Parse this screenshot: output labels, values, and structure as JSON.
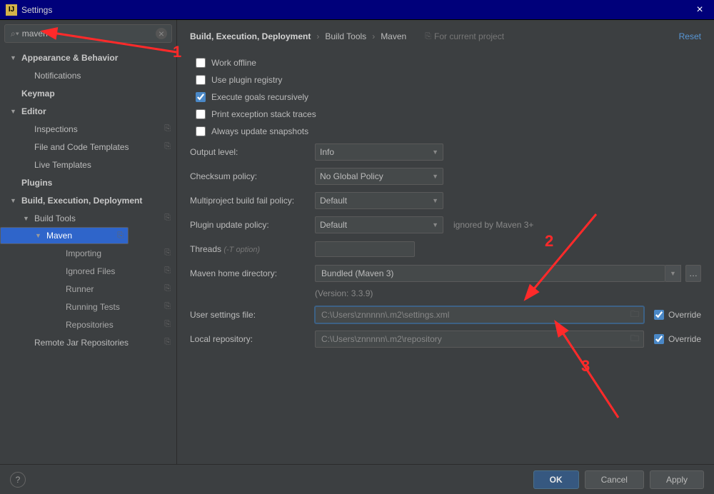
{
  "title": "Settings",
  "search": {
    "value": "maven"
  },
  "sidebar": [
    {
      "label": "Appearance & Behavior",
      "level": 0,
      "expandable": true,
      "expanded": true
    },
    {
      "label": "Notifications",
      "level": 1
    },
    {
      "label": "Keymap",
      "level": 0,
      "bold": true
    },
    {
      "label": "Editor",
      "level": 0,
      "expandable": true,
      "expanded": true
    },
    {
      "label": "Inspections",
      "level": 1,
      "copy": true
    },
    {
      "label": "File and Code Templates",
      "level": 1,
      "copy": true
    },
    {
      "label": "Live Templates",
      "level": 1
    },
    {
      "label": "Plugins",
      "level": 0,
      "bold": true
    },
    {
      "label": "Build, Execution, Deployment",
      "level": 0,
      "expandable": true,
      "expanded": true
    },
    {
      "label": "Build Tools",
      "level": 1,
      "expandable": true,
      "expanded": true,
      "copy": true
    },
    {
      "label": "Maven",
      "level": 2,
      "selected": true,
      "expandable": true,
      "expanded": true,
      "copy": true
    },
    {
      "label": "Importing",
      "level": 3,
      "copy": true
    },
    {
      "label": "Ignored Files",
      "level": 3,
      "copy": true
    },
    {
      "label": "Runner",
      "level": 3,
      "copy": true
    },
    {
      "label": "Running Tests",
      "level": 3,
      "copy": true
    },
    {
      "label": "Repositories",
      "level": 3,
      "copy": true
    },
    {
      "label": "Remote Jar Repositories",
      "level": 1,
      "copy": true
    }
  ],
  "breadcrumb": {
    "a": "Build, Execution, Deployment",
    "b": "Build Tools",
    "c": "Maven",
    "for_project": "For current project"
  },
  "reset": "Reset",
  "checks": {
    "work_offline": {
      "label": "Work offline",
      "checked": false
    },
    "use_plugin_registry": {
      "label": "Use plugin registry",
      "checked": false
    },
    "execute_goals_recursively": {
      "label": "Execute goals recursively",
      "checked": true
    },
    "print_exception_stack_traces": {
      "label": "Print exception stack traces",
      "checked": false
    },
    "always_update_snapshots": {
      "label": "Always update snapshots",
      "checked": false
    }
  },
  "fields": {
    "output_level": {
      "label": "Output level:",
      "value": "Info"
    },
    "checksum_policy": {
      "label": "Checksum policy:",
      "value": "No Global Policy"
    },
    "multiproject_fail": {
      "label": "Multiproject build fail policy:",
      "value": "Default"
    },
    "plugin_update": {
      "label": "Plugin update policy:",
      "value": "Default",
      "note": "ignored by Maven 3+"
    },
    "threads": {
      "label": "Threads ",
      "hint": "(-T option)",
      "value": ""
    },
    "maven_home": {
      "label": "Maven home directory:",
      "value": "Bundled (Maven 3)"
    },
    "version_note": "(Version: 3.3.9)",
    "user_settings": {
      "label": "User settings file:",
      "value": "C:\\Users\\znnnnn\\.m2\\settings.xml",
      "override": true
    },
    "local_repo": {
      "label": "Local repository:",
      "value": "C:\\Users\\znnnnn\\.m2\\repository",
      "override": true
    }
  },
  "override_label": "Override",
  "buttons": {
    "ok": "OK",
    "cancel": "Cancel",
    "apply": "Apply"
  },
  "help": "?",
  "annotations": {
    "n1": "1",
    "n2": "2",
    "n3": "3"
  }
}
